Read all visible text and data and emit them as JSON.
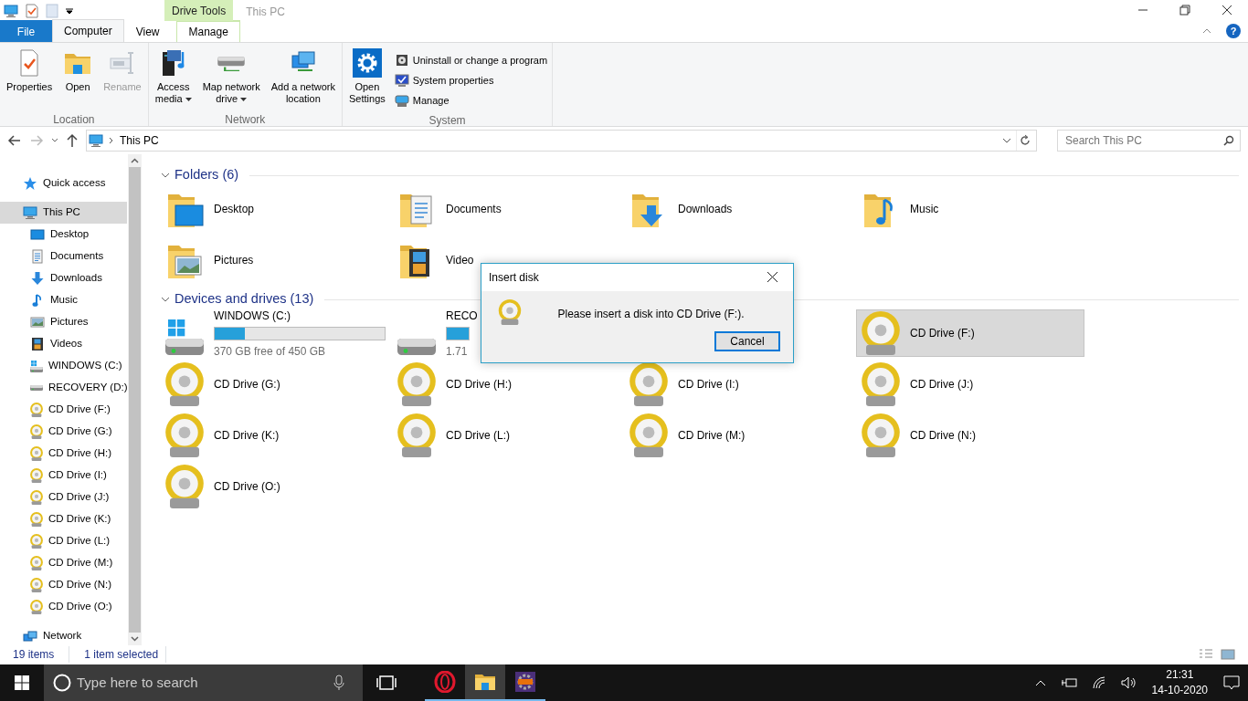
{
  "window": {
    "title": "This PC",
    "contextual_group": "Drive Tools",
    "help_glyph": "?"
  },
  "ribbon": {
    "tabs": [
      {
        "label": "File",
        "kind": "file",
        "selected": false
      },
      {
        "label": "Computer",
        "kind": "tab",
        "selected": true
      },
      {
        "label": "View",
        "kind": "tab",
        "selected": false
      },
      {
        "label": "Manage",
        "kind": "contextual",
        "selected": false
      }
    ],
    "groups": [
      {
        "label": "Location",
        "buttons": [
          {
            "label": "Properties",
            "kind": "properties",
            "disabled": false,
            "dropdown": false
          },
          {
            "label": "Open",
            "kind": "open",
            "disabled": false,
            "dropdown": false
          },
          {
            "label": "Rename",
            "kind": "rename",
            "disabled": true,
            "dropdown": false
          }
        ]
      },
      {
        "label": "Network",
        "buttons": [
          {
            "label": "Access\nmedia",
            "kind": "media",
            "disabled": false,
            "dropdown": true
          },
          {
            "label": "Map network\ndrive",
            "kind": "mapdrive",
            "disabled": false,
            "dropdown": true
          },
          {
            "label": "Add a network\nlocation",
            "kind": "netloc",
            "disabled": false,
            "dropdown": false
          }
        ]
      },
      {
        "label": "System",
        "buttons": [
          {
            "label": "Open\nSettings",
            "kind": "settings",
            "disabled": false,
            "dropdown": false
          }
        ],
        "small_buttons": [
          {
            "label": "Uninstall or change a program",
            "kind": "uninstall"
          },
          {
            "label": "System properties",
            "kind": "sysprops"
          },
          {
            "label": "Manage",
            "kind": "manage"
          }
        ]
      }
    ]
  },
  "address": {
    "path": "This PC",
    "search_placeholder": "Search This PC"
  },
  "sidebar": {
    "items": [
      {
        "label": "Quick access",
        "kind": "star",
        "selected": false
      },
      {
        "label": "This PC",
        "kind": "pc",
        "selected": true,
        "children": [
          {
            "label": "Desktop",
            "kind": "desktop",
            "selected": false
          },
          {
            "label": "Documents",
            "kind": "documents",
            "selected": false
          },
          {
            "label": "Downloads",
            "kind": "downloads",
            "selected": false
          },
          {
            "label": "Music",
            "kind": "music",
            "selected": false
          },
          {
            "label": "Pictures",
            "kind": "pictures",
            "selected": false
          },
          {
            "label": "Videos",
            "kind": "videos",
            "selected": false
          },
          {
            "label": "WINDOWS (C:)",
            "kind": "windrive",
            "selected": false
          },
          {
            "label": "RECOVERY (D:)",
            "kind": "drive",
            "selected": false
          },
          {
            "label": "CD Drive (F:)",
            "kind": "cd",
            "selected": false
          },
          {
            "label": "CD Drive (G:)",
            "kind": "cd",
            "selected": false
          },
          {
            "label": "CD Drive (H:)",
            "kind": "cd",
            "selected": false
          },
          {
            "label": "CD Drive (I:)",
            "kind": "cd",
            "selected": false
          },
          {
            "label": "CD Drive (J:)",
            "kind": "cd",
            "selected": false
          },
          {
            "label": "CD Drive (K:)",
            "kind": "cd",
            "selected": false
          },
          {
            "label": "CD Drive (L:)",
            "kind": "cd",
            "selected": false
          },
          {
            "label": "CD Drive (M:)",
            "kind": "cd",
            "selected": false
          },
          {
            "label": "CD Drive (N:)",
            "kind": "cd",
            "selected": false
          },
          {
            "label": "CD Drive (O:)",
            "kind": "cd",
            "selected": false
          }
        ]
      },
      {
        "label": "Network",
        "kind": "network",
        "selected": false
      }
    ]
  },
  "sections": [
    {
      "title": "Folders (6)",
      "expanded": true,
      "items": [
        {
          "label": "Desktop",
          "kind": "desktop",
          "selected": false
        },
        {
          "label": "Documents",
          "kind": "documents",
          "selected": false
        },
        {
          "label": "Downloads",
          "kind": "downloads",
          "selected": false
        },
        {
          "label": "Music",
          "kind": "music",
          "selected": false
        },
        {
          "label": "Pictures",
          "kind": "pictures",
          "selected": false
        },
        {
          "label": "Video",
          "kind": "videos",
          "selected": false
        }
      ]
    },
    {
      "title": "Devices and drives (13)",
      "expanded": true,
      "items": [
        {
          "label": "WINDOWS (C:)",
          "kind": "windrive",
          "selected": false,
          "level": 0.18,
          "free": "370 GB free of 450 GB"
        },
        {
          "label": "RECO",
          "kind": "drive",
          "selected": false,
          "level": 1,
          "free": "1.71"
        },
        {
          "kind": "covered"
        },
        {
          "label": "CD Drive (F:)",
          "kind": "cd",
          "selected": true
        },
        {
          "label": "CD Drive (G:)",
          "kind": "cd",
          "selected": false
        },
        {
          "label": "CD Drive (H:)",
          "kind": "cd",
          "selected": false
        },
        {
          "label": "CD Drive (I:)",
          "kind": "cd",
          "selected": false
        },
        {
          "label": "CD Drive (J:)",
          "kind": "cd",
          "selected": false
        },
        {
          "label": "CD Drive (K:)",
          "kind": "cd",
          "selected": false
        },
        {
          "label": "CD Drive (L:)",
          "kind": "cd",
          "selected": false
        },
        {
          "label": "CD Drive (M:)",
          "kind": "cd",
          "selected": false
        },
        {
          "label": "CD Drive (N:)",
          "kind": "cd",
          "selected": false
        },
        {
          "label": "CD Drive (O:)",
          "kind": "cd",
          "selected": false
        }
      ]
    }
  ],
  "dialog": {
    "title": "Insert disk",
    "message": "Please insert a disk into CD Drive (F:).",
    "button": "Cancel"
  },
  "status_bar": {
    "count": "19 items",
    "selection": "1 item selected"
  },
  "taskbar": {
    "search_placeholder": "Type here to search",
    "apps": [
      {
        "kind": "opera",
        "running": true,
        "active": false
      },
      {
        "kind": "explorer",
        "running": true,
        "active": true
      },
      {
        "kind": "ide",
        "running": true,
        "active": false
      }
    ],
    "time": "21:31",
    "date": "14-10-2020"
  }
}
